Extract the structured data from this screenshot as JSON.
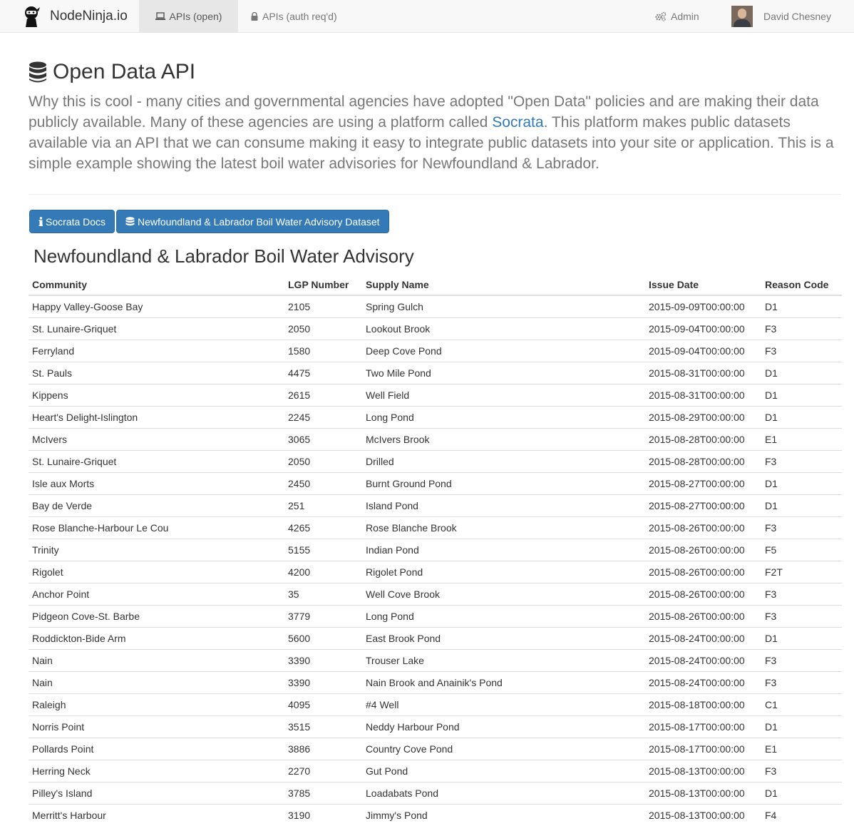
{
  "nav": {
    "brand": "NodeNinja.io",
    "tab_open": "APIs (open)",
    "tab_auth": "APIs (auth req'd)",
    "admin": "Admin",
    "user": "David Chesney"
  },
  "header": {
    "title": "Open Data API",
    "lead_before": "Why this is cool - many cities and governmental agencies have adopted \"Open Data\" policies and are making their data publicly available. Many of these agencies are using a platform called ",
    "lead_link": "Socrata",
    "lead_after": ". This platform makes public datasets available via an API that we can consume making it easy to integrate public datasets into your site or application. This is a simple example showing the latest boil water advisories for Newfoundland & Labrador."
  },
  "buttons": {
    "docs": "Socrata Docs",
    "dataset": "Newfoundland & Labrador Boil Water Advisory Dataset"
  },
  "table": {
    "title": "Newfoundland & Labrador Boil Water Advisory",
    "headers": [
      "Community",
      "LGP Number",
      "Supply Name",
      "Issue Date",
      "Reason Code"
    ],
    "rows": [
      [
        "Happy Valley-Goose Bay",
        "2105",
        "Spring Gulch",
        "2015-09-09T00:00:00",
        "D1"
      ],
      [
        "St. Lunaire-Griquet",
        "2050",
        "Lookout Brook",
        "2015-09-04T00:00:00",
        "F3"
      ],
      [
        "Ferryland",
        "1580",
        "Deep Cove Pond",
        "2015-09-04T00:00:00",
        "F3"
      ],
      [
        "St. Pauls",
        "4475",
        "Two Mile Pond",
        "2015-08-31T00:00:00",
        "D1"
      ],
      [
        "Kippens",
        "2615",
        "Well Field",
        "2015-08-31T00:00:00",
        "D1"
      ],
      [
        "Heart's Delight-Islington",
        "2245",
        "Long Pond",
        "2015-08-29T00:00:00",
        "D1"
      ],
      [
        "McIvers",
        "3065",
        "McIvers Brook",
        "2015-08-28T00:00:00",
        "E1"
      ],
      [
        "St. Lunaire-Griquet",
        "2050",
        "Drilled",
        "2015-08-28T00:00:00",
        "F3"
      ],
      [
        "Isle aux Morts",
        "2450",
        "Burnt Ground Pond",
        "2015-08-27T00:00:00",
        "D1"
      ],
      [
        "Bay de Verde",
        "251",
        "Island Pond",
        "2015-08-27T00:00:00",
        "D1"
      ],
      [
        "Rose Blanche-Harbour Le Cou",
        "4265",
        "Rose Blanche Brook",
        "2015-08-26T00:00:00",
        "F3"
      ],
      [
        "Trinity",
        "5155",
        "Indian Pond",
        "2015-08-26T00:00:00",
        "F5"
      ],
      [
        "Rigolet",
        "4200",
        "Rigolet Pond",
        "2015-08-26T00:00:00",
        "F2T"
      ],
      [
        "Anchor Point",
        "35",
        "Well Cove Brook",
        "2015-08-26T00:00:00",
        "F3"
      ],
      [
        "Pidgeon Cove-St. Barbe",
        "3779",
        "Long Pond",
        "2015-08-26T00:00:00",
        "F3"
      ],
      [
        "Roddickton-Bide Arm",
        "5600",
        "East Brook Pond",
        "2015-08-24T00:00:00",
        "D1"
      ],
      [
        "Nain",
        "3390",
        "Trouser Lake",
        "2015-08-24T00:00:00",
        "F3"
      ],
      [
        "Nain",
        "3390",
        "Nain Brook and Anainik's Pond",
        "2015-08-24T00:00:00",
        "F3"
      ],
      [
        "Raleigh",
        "4095",
        "#4 Well",
        "2015-08-18T00:00:00",
        "C1"
      ],
      [
        "Norris Point",
        "3515",
        "Neddy Harbour Pond",
        "2015-08-17T00:00:00",
        "D1"
      ],
      [
        "Pollards Point",
        "3886",
        "Country Cove Pond",
        "2015-08-17T00:00:00",
        "E1"
      ],
      [
        "Herring Neck",
        "2270",
        "Gut Pond",
        "2015-08-13T00:00:00",
        "F3"
      ],
      [
        "Pilley's Island",
        "3785",
        "Loadabats Pond",
        "2015-08-13T00:00:00",
        "D1"
      ],
      [
        "Merritt's Harbour",
        "3190",
        "Jimmy's Pond",
        "2015-08-13T00:00:00",
        "F4"
      ]
    ]
  },
  "colors": {
    "primary": "#337ab7",
    "navbar_bg": "#f8f8f8",
    "lead_text": "#777777"
  }
}
